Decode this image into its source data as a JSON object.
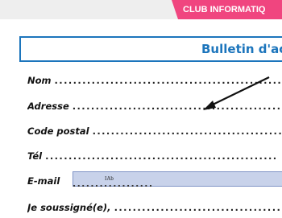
{
  "header": {
    "club_label": "CLUB INFORMATIQ",
    "colors": {
      "club_tab": "#f0457f",
      "title_border": "#1c75bc",
      "title_text": "#1c75bc",
      "email_field": "#c8d2ea"
    }
  },
  "form": {
    "title": "Bulletin d'ac",
    "fields": {
      "nom": "Nom",
      "adresse": "Adresse",
      "code_postal": "Code postal",
      "tel": "Tél",
      "email": "E-mail",
      "je_soussigne": "Je soussigné(e),"
    },
    "email_input_value": "IAb"
  },
  "icons": {
    "arrow": "arrow-icon"
  }
}
